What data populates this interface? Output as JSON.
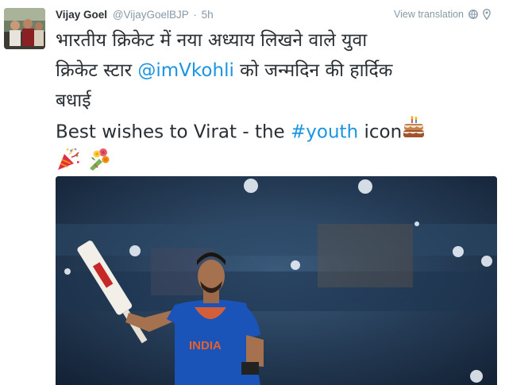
{
  "tweet": {
    "author_name": "Vijay Goel",
    "handle": "@VijayGoelBJP",
    "separator": "·",
    "time": "5h",
    "view_translation": "View translation",
    "text": {
      "line1": "भारतीय क्रिकेट में नया अध्याय लिखने वाले युवा",
      "line2_pre": "क्रिकेट स्टार ",
      "mention": "@imVkohli",
      "line2_post": " को जन्मदिन की हार्दिक",
      "line3": "बधाई",
      "line4_pre": "Best wishes to Virat - the ",
      "hashtag": "#youth",
      "line4_post": " icon"
    },
    "emojis": [
      "birthday-cake-icon",
      "party-popper-icon",
      "bouquet-icon"
    ],
    "photo_caption": "INDIA"
  },
  "colors": {
    "link": "#1b95e0",
    "meta_gray": "#8899a6",
    "text": "#292f33",
    "jersey_blue": "#1a54b8"
  }
}
